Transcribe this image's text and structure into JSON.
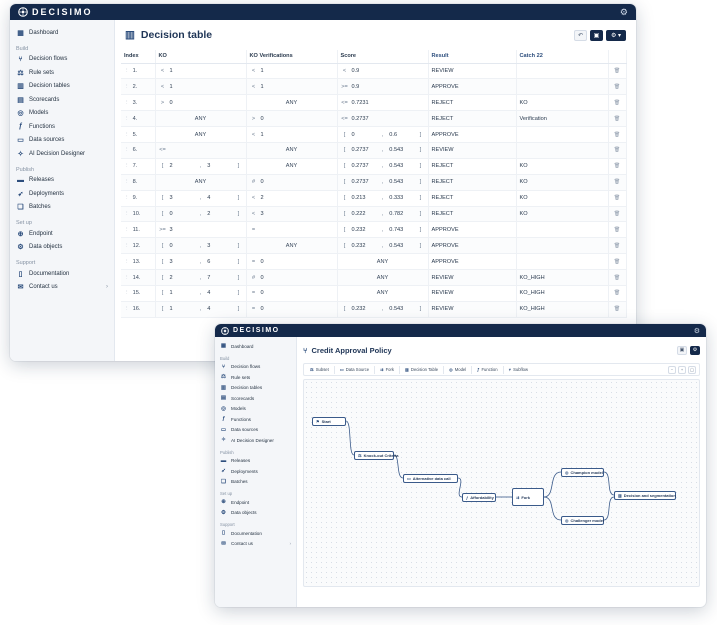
{
  "app": {
    "name": "DECISIMO"
  },
  "sidebar": {
    "dashboard": "Dashboard",
    "build_heading": "Build",
    "build": [
      {
        "label": "Decision flows",
        "icon": "decision-flows-icon"
      },
      {
        "label": "Rule sets",
        "icon": "rule-sets-icon"
      },
      {
        "label": "Decision tables",
        "icon": "decision-tables-icon"
      },
      {
        "label": "Scorecards",
        "icon": "scorecards-icon"
      },
      {
        "label": "Models",
        "icon": "models-icon"
      },
      {
        "label": "Functions",
        "icon": "functions-icon"
      },
      {
        "label": "Data sources",
        "icon": "data-sources-icon"
      },
      {
        "label": "AI Decision Designer",
        "icon": "ai-designer-icon"
      }
    ],
    "publish_heading": "Publish",
    "publish": [
      {
        "label": "Releases",
        "icon": "releases-icon"
      },
      {
        "label": "Deployments",
        "icon": "deployments-icon"
      },
      {
        "label": "Batches",
        "icon": "batches-icon"
      }
    ],
    "setup_heading": "Set up",
    "setup": [
      {
        "label": "Endpoint",
        "icon": "endpoint-icon"
      },
      {
        "label": "Data objects",
        "icon": "data-objects-icon"
      }
    ],
    "support_heading": "Support",
    "support": [
      {
        "label": "Documentation",
        "icon": "documentation-icon"
      },
      {
        "label": "Contact us",
        "icon": "contact-icon"
      }
    ]
  },
  "decision_table": {
    "title": "Decision table",
    "columns": {
      "index": "Index",
      "ko": "KO",
      "ko_verifications": "KO Verifications",
      "score": "Score",
      "result": "Result",
      "catch22": "Catch 22"
    },
    "rows": [
      {
        "idx": "1.",
        "ko_op": "<",
        "ko": "1",
        "kov_op": "<",
        "kov": "1",
        "sc_op": "<",
        "sc": "0.9",
        "result": "REVIEW",
        "catch": ""
      },
      {
        "idx": "2.",
        "ko_op": "<",
        "ko": "1",
        "kov_op": "<",
        "kov": "1",
        "sc_op": ">=",
        "sc": "0.9",
        "result": "APPROVE",
        "catch": ""
      },
      {
        "idx": "3.",
        "ko_op": ">",
        "ko": "0",
        "kov_any": "ANY",
        "sc_op": "<=",
        "sc": "0.7231",
        "result": "REJECT",
        "catch": "KO"
      },
      {
        "idx": "4.",
        "ko_any": "ANY",
        "kov_op": ">",
        "kov": "0",
        "sc_op": "<=",
        "sc": "0.2737",
        "result": "REJECT",
        "catch": "Verification"
      },
      {
        "idx": "5.",
        "ko_any": "ANY",
        "kov_op": "<",
        "kov": "1",
        "sc_lo": "0",
        "sc_hi": "0.6",
        "result": "APPROVE",
        "catch": ""
      },
      {
        "idx": "6.",
        "ko_op": "<=",
        "ko": "",
        "kov_any": "ANY",
        "sc_lo": "0.2737",
        "sc_hi": "0.543",
        "result": "REVIEW",
        "catch": ""
      },
      {
        "idx": "7.",
        "ko_lo": "2",
        "ko_hi": "3",
        "kov_any": "ANY",
        "sc_lo": "0.2737",
        "sc_hi": "0.543",
        "result": "REJECT",
        "catch": "KO"
      },
      {
        "idx": "8.",
        "ko_any": "ANY",
        "kov_op": "#",
        "kov": "0",
        "sc_lo": "0.2737",
        "sc_hi": "0.543",
        "result": "REJECT",
        "catch": "KO"
      },
      {
        "idx": "9.",
        "ko_lo": "3",
        "ko_hi": "4",
        "kov_op": "<",
        "kov": "2",
        "sc_lo": "0.213",
        "sc_hi": "0.333",
        "result": "REJECT",
        "catch": "KO"
      },
      {
        "idx": "10.",
        "ko_lo": "0",
        "ko_hi": "2",
        "kov_op": "<",
        "kov": "3",
        "sc_lo": "0.222",
        "sc_hi": "0.782",
        "result": "REJECT",
        "catch": "KO"
      },
      {
        "idx": "11.",
        "ko_op": ">=",
        "ko": "3",
        "kov_op": "=",
        "kov": "",
        "sc_lo": "0.232",
        "sc_hi": "0.743",
        "result": "APPROVE",
        "catch": ""
      },
      {
        "idx": "12.",
        "ko_lo": "0",
        "ko_hi": "3",
        "kov_any": "ANY",
        "sc_lo": "0.232",
        "sc_hi": "0.543",
        "result": "APPROVE",
        "catch": ""
      },
      {
        "idx": "13.",
        "ko_lo": "3",
        "ko_hi": "6",
        "kov_op": "=",
        "kov": "0",
        "sc_any": "ANY",
        "result": "APPROVE",
        "catch": ""
      },
      {
        "idx": "14.",
        "ko_lo": "2",
        "ko_hi": "7",
        "kov_op": "#",
        "kov": "0",
        "sc_any": "ANY",
        "result": "REVIEW",
        "catch": "KO_HIGH"
      },
      {
        "idx": "15.",
        "ko_lo": "1",
        "ko_hi": "4",
        "kov_op": "=",
        "kov": "0",
        "sc_any": "ANY",
        "result": "REVIEW",
        "catch": "KO_HIGH"
      },
      {
        "idx": "16.",
        "ko_lo": "1",
        "ko_hi": "4",
        "kov_op": "=",
        "kov": "0",
        "sc_lo": "0.232",
        "sc_hi": "0.543",
        "result": "REVIEW",
        "catch": "KO_HIGH"
      }
    ]
  },
  "flow": {
    "title": "Credit Approval Policy",
    "toolbar": [
      "Subset",
      "Data Source",
      "Fork",
      "Decision Table",
      "Model",
      "Function",
      "Subflow"
    ],
    "nodes": [
      {
        "label": "Start",
        "icon": "flag-icon"
      },
      {
        "label": "Knock-out Criteria",
        "icon": "rule-set-icon"
      },
      {
        "label": "Alternative data call",
        "icon": "data-source-icon"
      },
      {
        "label": "Affordability",
        "icon": "function-icon"
      },
      {
        "label": "Fork",
        "icon": "fork-icon"
      },
      {
        "label": "Champion model",
        "icon": "model-icon"
      },
      {
        "label": "Challenger model",
        "icon": "model-icon"
      },
      {
        "label": "Decision and segmentation",
        "icon": "decision-table-icon"
      }
    ]
  }
}
